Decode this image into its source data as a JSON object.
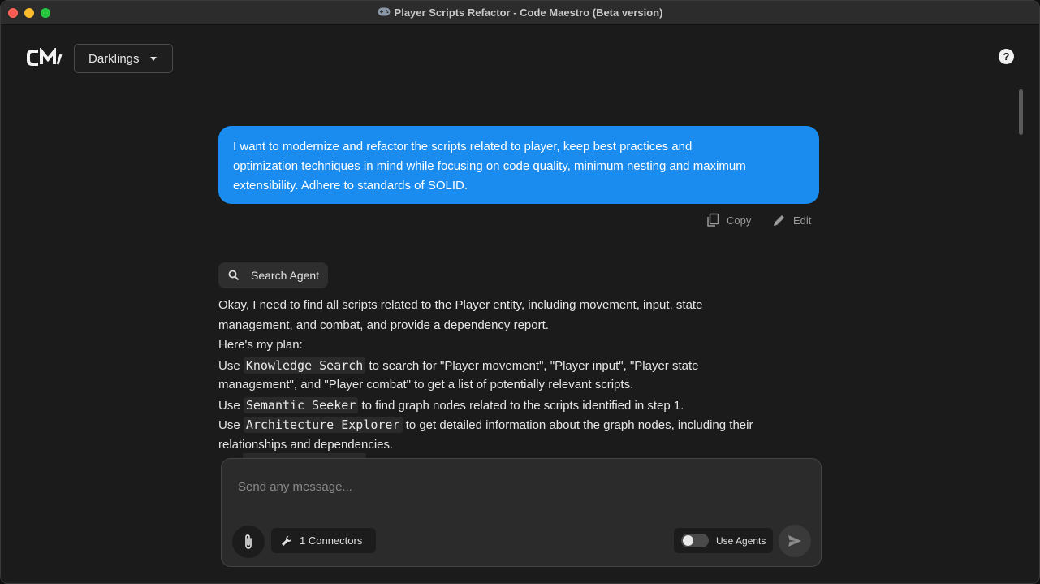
{
  "window": {
    "title": "Player Scripts Refactor - Code Maestro (Beta version)",
    "title_icon": "gamepad-icon"
  },
  "header": {
    "logo_text": "CM",
    "project_select": {
      "value": "Darklings"
    },
    "help_label": "?"
  },
  "user_message": {
    "lines": [
      "I want to modernize and refactor the scripts related to player, keep best practices and",
      "optimization techniques in mind while focusing on code quality, minimum nesting and maximum",
      "extensibility. Adhere to standards of SOLID."
    ],
    "actions": {
      "copy_label": "Copy",
      "edit_label": "Edit"
    }
  },
  "agent": {
    "badge_label": "Search Agent",
    "response": {
      "line1": "Okay, I need to find all scripts related to the Player entity, including movement, input, state",
      "line2": "management, and combat, and provide a dependency report.",
      "line3": "Here's my plan:",
      "step1_prefix": "Use ",
      "step1_tool": "Knowledge Search",
      "step1_suffix": " to search for \"Player movement\", \"Player input\", \"Player state",
      "step1_cont": "management\", and \"Player combat\" to get a list of potentially relevant scripts.",
      "step2_prefix": "Use ",
      "step2_tool": "Semantic Seeker",
      "step2_suffix": " to find graph nodes related to the scripts identified in step 1.",
      "step3_prefix": "Use ",
      "step3_tool": "Architecture Explorer",
      "step3_suffix": " to get detailed information about the graph nodes, including their",
      "step3_cont": "relationships and dependencies."
    }
  },
  "composer": {
    "placeholder": "Send any message...",
    "connectors_label": "1 Connectors",
    "use_agents_label": "Use Agents",
    "use_agents_enabled": false
  },
  "colors": {
    "accent": "#1a8cf0",
    "background": "#1b1b1b"
  }
}
